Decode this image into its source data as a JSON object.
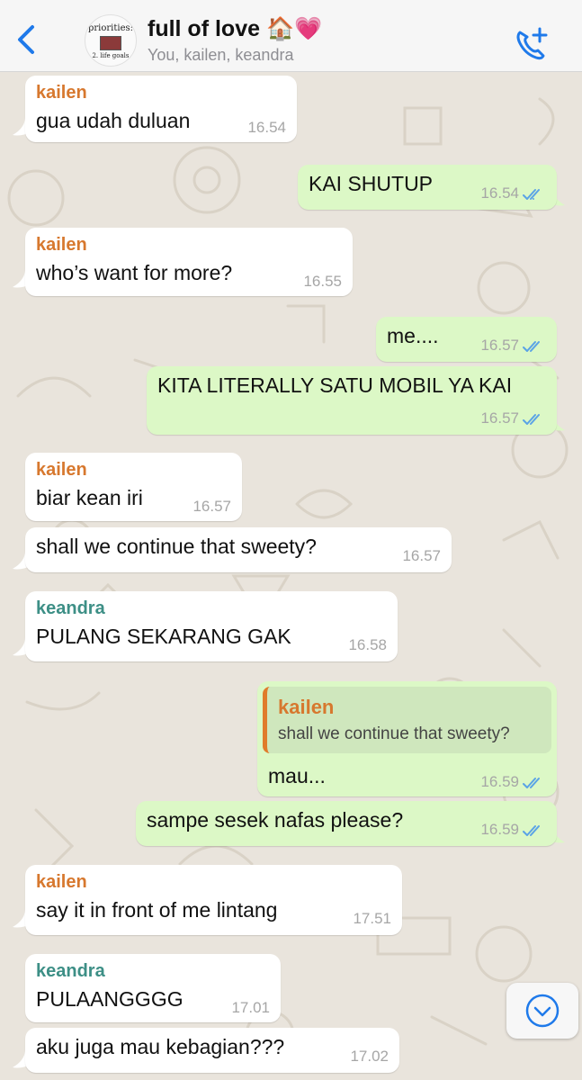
{
  "header": {
    "avatar_line1": "priorities:",
    "avatar_line2": "2. life goals",
    "title": "full of love 🏠💗",
    "members": "You, kailen, keandra"
  },
  "messages": [
    {
      "direction": "in",
      "sender": "kailen",
      "text": "gua udah duluan",
      "time": "16.54"
    },
    {
      "direction": "out",
      "text": "KAI SHUTUP",
      "time": "16.54",
      "status": "read"
    },
    {
      "direction": "in",
      "sender": "kailen",
      "text": "who’s want for more?",
      "time": "16.55"
    },
    {
      "direction": "out",
      "text": "me....",
      "time": "16.57",
      "status": "read"
    },
    {
      "direction": "out",
      "text": "KITA LITERALLY SATU MOBIL YA KAI",
      "time": "16.57",
      "status": "read"
    },
    {
      "direction": "in",
      "sender": "kailen",
      "text": "biar kean iri",
      "time": "16.57"
    },
    {
      "direction": "in",
      "text": "shall we continue that sweety?",
      "time": "16.57"
    },
    {
      "direction": "in",
      "sender": "keandra",
      "text": "PULANG SEKARANG GAK",
      "time": "16.58"
    },
    {
      "direction": "out",
      "quote": {
        "sender": "kailen",
        "text": "shall we continue that sweety?"
      },
      "text": "mau...",
      "time": "16.59",
      "status": "read"
    },
    {
      "direction": "out",
      "text": "sampe sesek nafas please?",
      "time": "16.59",
      "status": "read"
    },
    {
      "direction": "in",
      "sender": "kailen",
      "text": "say it in front of me lintang",
      "time": "17.51"
    },
    {
      "direction": "in",
      "sender": "keandra",
      "text": "PULAANGGGG",
      "time": "17.01"
    },
    {
      "direction": "in",
      "text": "aku juga mau kebagian???",
      "time": "17.02"
    }
  ],
  "colors": {
    "accent": "#1f7aea",
    "sender_kailen": "#d7782e",
    "sender_keandra": "#3d8f86",
    "outgoing_bubble": "#dcf8c6",
    "incoming_bubble": "#ffffff",
    "read_ticks": "#5aa3e6"
  },
  "icons": {
    "back": "chevron-left-icon",
    "call": "add-call-icon",
    "read": "double-check-icon",
    "scroll": "chevron-down-icon"
  }
}
